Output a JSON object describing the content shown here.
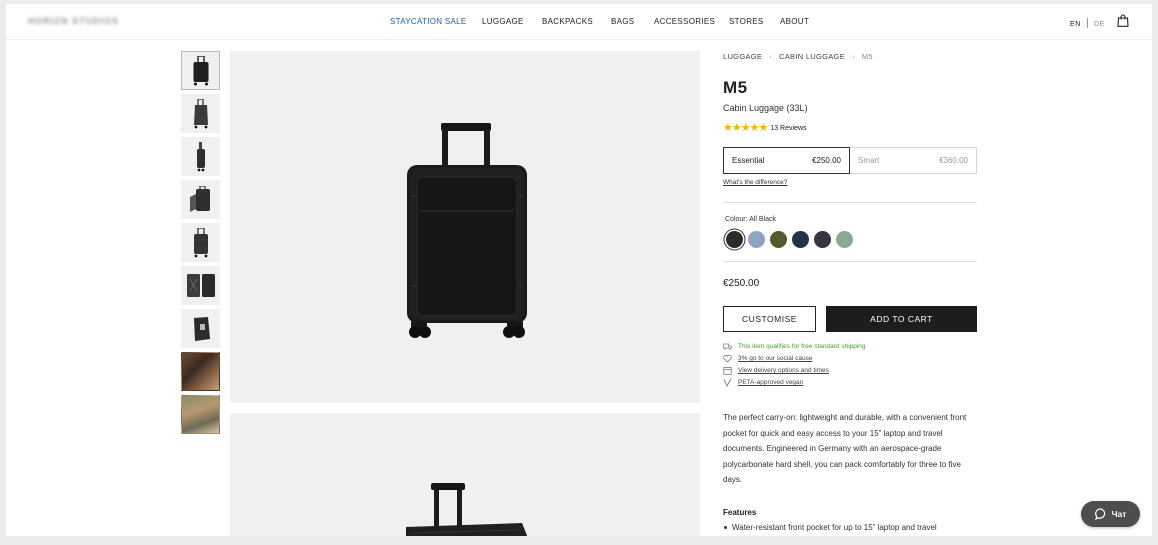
{
  "header": {
    "logo": "HORIZN STUDIOS",
    "nav": [
      {
        "label": "STAYCATION SALE",
        "active": true
      },
      {
        "label": "LUGGAGE",
        "active": false
      },
      {
        "label": "BACKPACKS",
        "active": false
      },
      {
        "label": "BAGS",
        "active": false
      },
      {
        "label": "ACCESSORIES",
        "active": false
      },
      {
        "label": "STORES",
        "active": false
      },
      {
        "label": "ABOUT",
        "active": false
      }
    ],
    "lang_en": "EN",
    "lang_de": "DE",
    "cart_icon": "shopping-bag-icon",
    "active_color": "#1f5fa0"
  },
  "breadcrumb": [
    "LUGGAGE",
    "CABIN LUGGAGE",
    "M5"
  ],
  "product": {
    "name": "M5",
    "subtitle": "Cabin Luggage (33L)",
    "rating_stars": 5,
    "reviews": "13 Reviews",
    "variants": [
      {
        "name": "Essential",
        "price": "€250.00",
        "selected": true
      },
      {
        "name": "Smart",
        "price": "€360.00",
        "selected": false
      }
    ],
    "difference_link": "What's the difference?",
    "colour_label": "Colour: All Black",
    "colours": [
      {
        "name": "All Black",
        "hex": "#2b2b2b",
        "selected": true
      },
      {
        "name": "Light Blue",
        "hex": "#8fa4c0",
        "selected": false
      },
      {
        "name": "Olive",
        "hex": "#545a2c",
        "selected": false
      },
      {
        "name": "Navy",
        "hex": "#243149",
        "selected": false
      },
      {
        "name": "Graphite",
        "hex": "#34373d",
        "selected": false
      },
      {
        "name": "Sage",
        "hex": "#8aa894",
        "selected": false
      }
    ],
    "price": "€250.00",
    "customise_label": "CUSTOMISE",
    "add_to_cart_label": "ADD TO CART",
    "perks": [
      {
        "text": "This item qualifies for free standard shipping",
        "icon": "truck-icon",
        "style": "green"
      },
      {
        "text": "3% go to our social cause",
        "icon": "heart-icon",
        "style": "link"
      },
      {
        "text": "View delivery options and times",
        "icon": "calendar-icon",
        "style": "link"
      },
      {
        "text": "PETA-approved vegan",
        "icon": "vegan-icon",
        "style": "link"
      }
    ],
    "description": "The perfect carry-on: lightweight and durable, with a convenient front pocket for quick and easy access to your 15” laptop and travel documents. Engineered in Germany with an aerospace-grade polycarbonate hard shell, you can pack comfortably for three to five days.",
    "features_heading": "Features",
    "features": [
      "Water-resistant front pocket for up to 15” laptop and travel"
    ]
  },
  "gallery": {
    "thumbnails": [
      {
        "kind": "suitcase-front",
        "selected": true
      },
      {
        "kind": "suitcase-angle",
        "selected": false
      },
      {
        "kind": "suitcase-side",
        "selected": false
      },
      {
        "kind": "suitcase-open-pocket",
        "selected": false
      },
      {
        "kind": "suitcase-back",
        "selected": false
      },
      {
        "kind": "suitcase-open",
        "selected": false
      },
      {
        "kind": "suitcase-monogram",
        "selected": false
      },
      {
        "kind": "lifestyle-photo",
        "selected": false
      },
      {
        "kind": "lifestyle-photo",
        "selected": false
      }
    ]
  },
  "chat": {
    "label": "Чат"
  }
}
